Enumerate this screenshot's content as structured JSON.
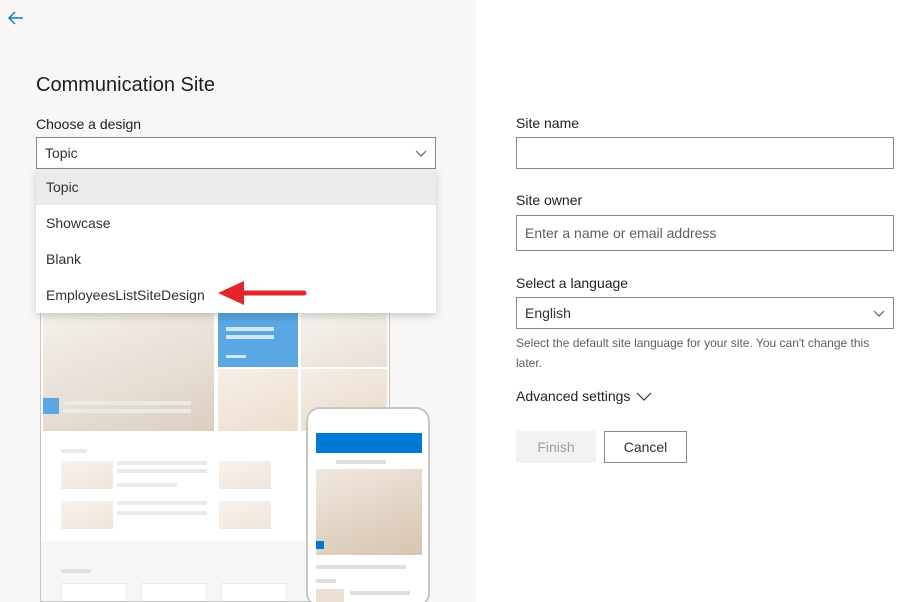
{
  "panel": {
    "title": "Communication Site",
    "choose_label": "Choose a design",
    "design_selected": "Topic",
    "design_options": [
      "Topic",
      "Showcase",
      "Blank",
      "EmployeesListSiteDesign"
    ]
  },
  "form": {
    "site_name_label": "Site name",
    "site_name_value": "",
    "site_owner_label": "Site owner",
    "site_owner_placeholder": "Enter a name or email address",
    "language_label": "Select a language",
    "language_value": "English",
    "language_help": "Select the default site language for your site. You can't change this later.",
    "advanced_label": "Advanced settings",
    "finish_label": "Finish",
    "cancel_label": "Cancel"
  },
  "colors": {
    "accent": "#0078d4",
    "arrow": "#e3242b"
  }
}
